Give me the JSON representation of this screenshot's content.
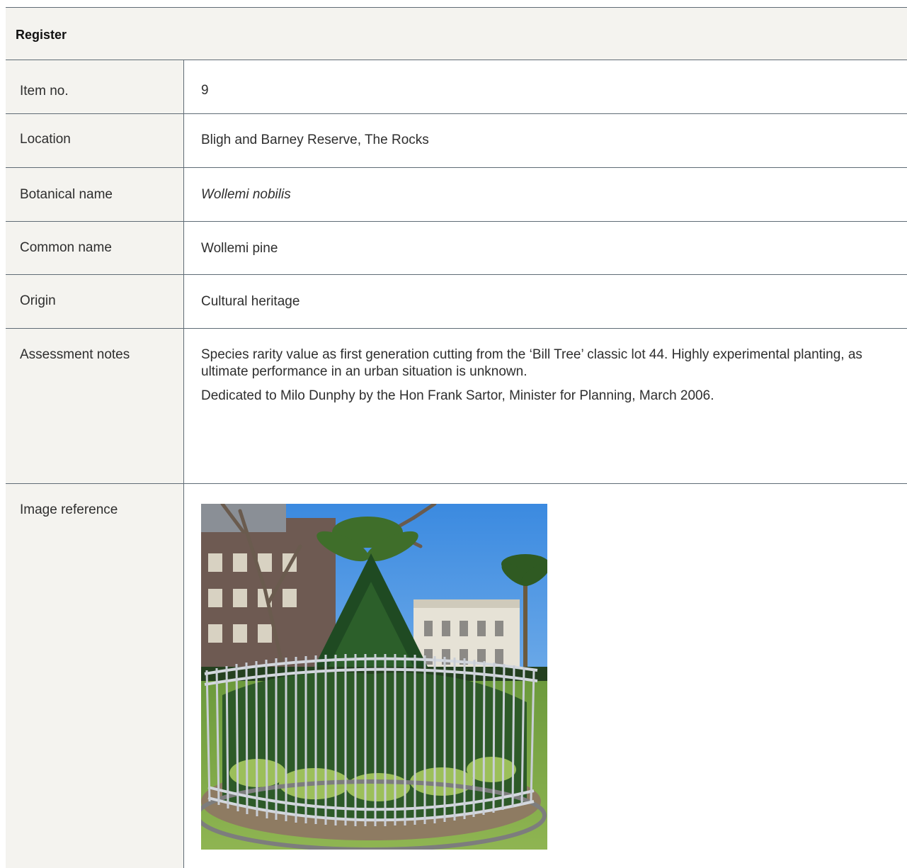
{
  "register": {
    "title": "Register",
    "rows": {
      "item_no": {
        "label": "Item no.",
        "value": "9"
      },
      "location": {
        "label": "Location",
        "value": "Bligh and Barney Reserve, The Rocks"
      },
      "botanical_name": {
        "label": "Botanical name",
        "value": "Wollemi nobilis"
      },
      "common_name": {
        "label": "Common name",
        "value": "Wollemi pine"
      },
      "origin": {
        "label": "Origin",
        "value": "Cultural heritage"
      },
      "assessment_notes": {
        "label": "Assessment notes",
        "paragraphs": [
          "Species rarity value as first generation cutting from the ‘Bill Tree’ classic lot 44. Highly experimental planting, as ultimate performance in an urban situation is unknown.",
          "Dedicated to Milo Dunphy by the Hon Frank Sartor, Minister for Planning, March 2006."
        ]
      },
      "image_reference": {
        "label": "Image reference"
      }
    }
  },
  "colors": {
    "label_bg": "#f4f3ef",
    "rule": "#5f6b75",
    "text": "#2e2e2e"
  }
}
